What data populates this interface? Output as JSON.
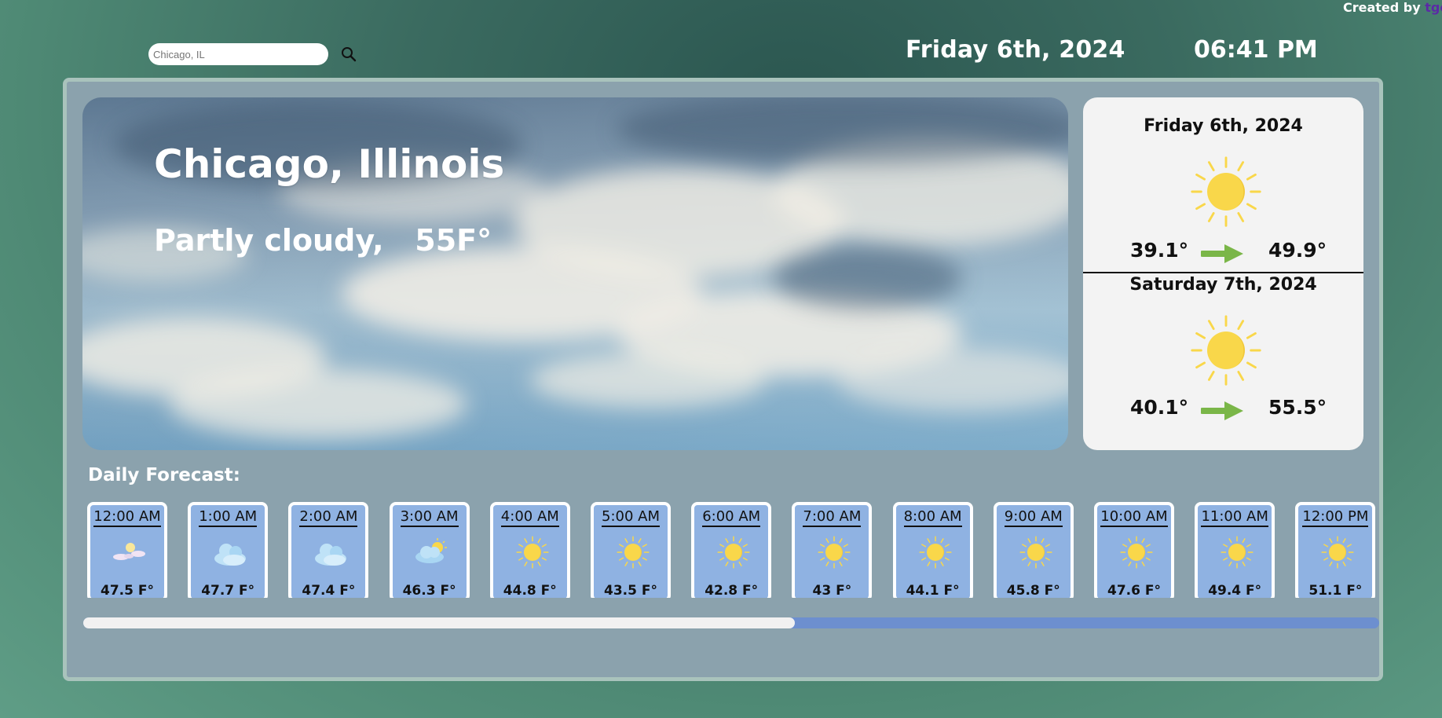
{
  "credit": {
    "prefix": "Created by ",
    "link": "tgorsl"
  },
  "search": {
    "placeholder": "Chicago, IL",
    "value": ""
  },
  "header": {
    "date": "Friday 6th, 2024",
    "time": "06:41 PM"
  },
  "hero": {
    "city": "Chicago, Illinois",
    "condition": "Partly cloudy,",
    "temperature": "55F°"
  },
  "days": [
    {
      "date": "Friday 6th, 2024",
      "icon": "sun-icon",
      "low": "39.1°",
      "high": "49.9°"
    },
    {
      "date": "Saturday 7th, 2024",
      "icon": "sun-icon",
      "low": "40.1°",
      "high": "55.5°"
    }
  ],
  "forecast": {
    "label": "Daily Forecast:",
    "hours": [
      {
        "time": "12:00 AM",
        "icon": "moon-cloud-icon",
        "temp": "47.5 F°"
      },
      {
        "time": "1:00 AM",
        "icon": "cloud-icon",
        "temp": "47.7 F°"
      },
      {
        "time": "2:00 AM",
        "icon": "cloud-icon",
        "temp": "47.4 F°"
      },
      {
        "time": "3:00 AM",
        "icon": "partly-cloudy-icon",
        "temp": "46.3 F°"
      },
      {
        "time": "4:00 AM",
        "icon": "sun-icon",
        "temp": "44.8 F°"
      },
      {
        "time": "5:00 AM",
        "icon": "sun-icon",
        "temp": "43.5 F°"
      },
      {
        "time": "6:00 AM",
        "icon": "sun-icon",
        "temp": "42.8 F°"
      },
      {
        "time": "7:00 AM",
        "icon": "sun-icon",
        "temp": "43 F°"
      },
      {
        "time": "8:00 AM",
        "icon": "sun-icon",
        "temp": "44.1 F°"
      },
      {
        "time": "9:00 AM",
        "icon": "sun-icon",
        "temp": "45.8 F°"
      },
      {
        "time": "10:00 AM",
        "icon": "sun-icon",
        "temp": "47.6 F°"
      },
      {
        "time": "11:00 AM",
        "icon": "sun-icon",
        "temp": "49.4 F°"
      },
      {
        "time": "12:00 PM",
        "icon": "sun-icon",
        "temp": "51.1 F°"
      }
    ]
  },
  "scroll": {
    "position": 0.55
  },
  "colors": {
    "sun": "#f9d74a",
    "arrow": "#7ab648",
    "card": "#8fb2e2",
    "panel": "#8ba2ad"
  }
}
